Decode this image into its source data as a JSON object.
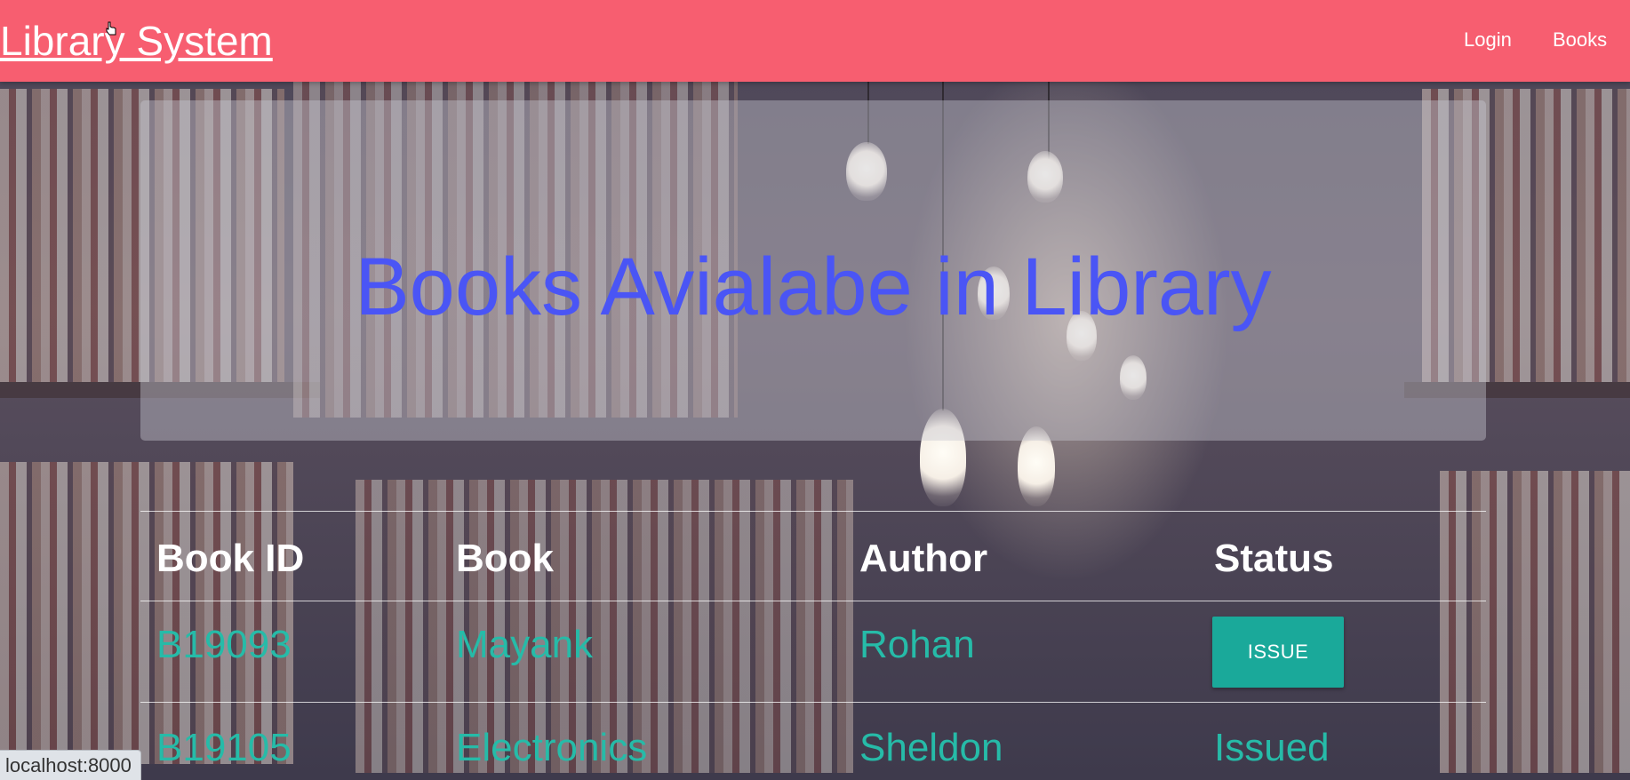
{
  "navbar": {
    "brand": "Library System",
    "links": [
      "Login",
      "Books"
    ],
    "color": "#f75e70"
  },
  "hero": {
    "title": "Books Avialabe in Library",
    "title_color": "#4a55f5"
  },
  "table": {
    "headers": [
      "Book ID",
      "Book",
      "Author",
      "Status"
    ],
    "rows": [
      {
        "book_id": "B19093",
        "book": "Mayank",
        "author": "Rohan",
        "status": "ISSUE"
      },
      {
        "book_id": "B19105",
        "book": "Electronics",
        "author": "Sheldon",
        "status": "Issued"
      }
    ],
    "data_color": "#26bba8",
    "button_color": "#1aa99a"
  },
  "statusbar": {
    "url": "localhost:8000"
  }
}
